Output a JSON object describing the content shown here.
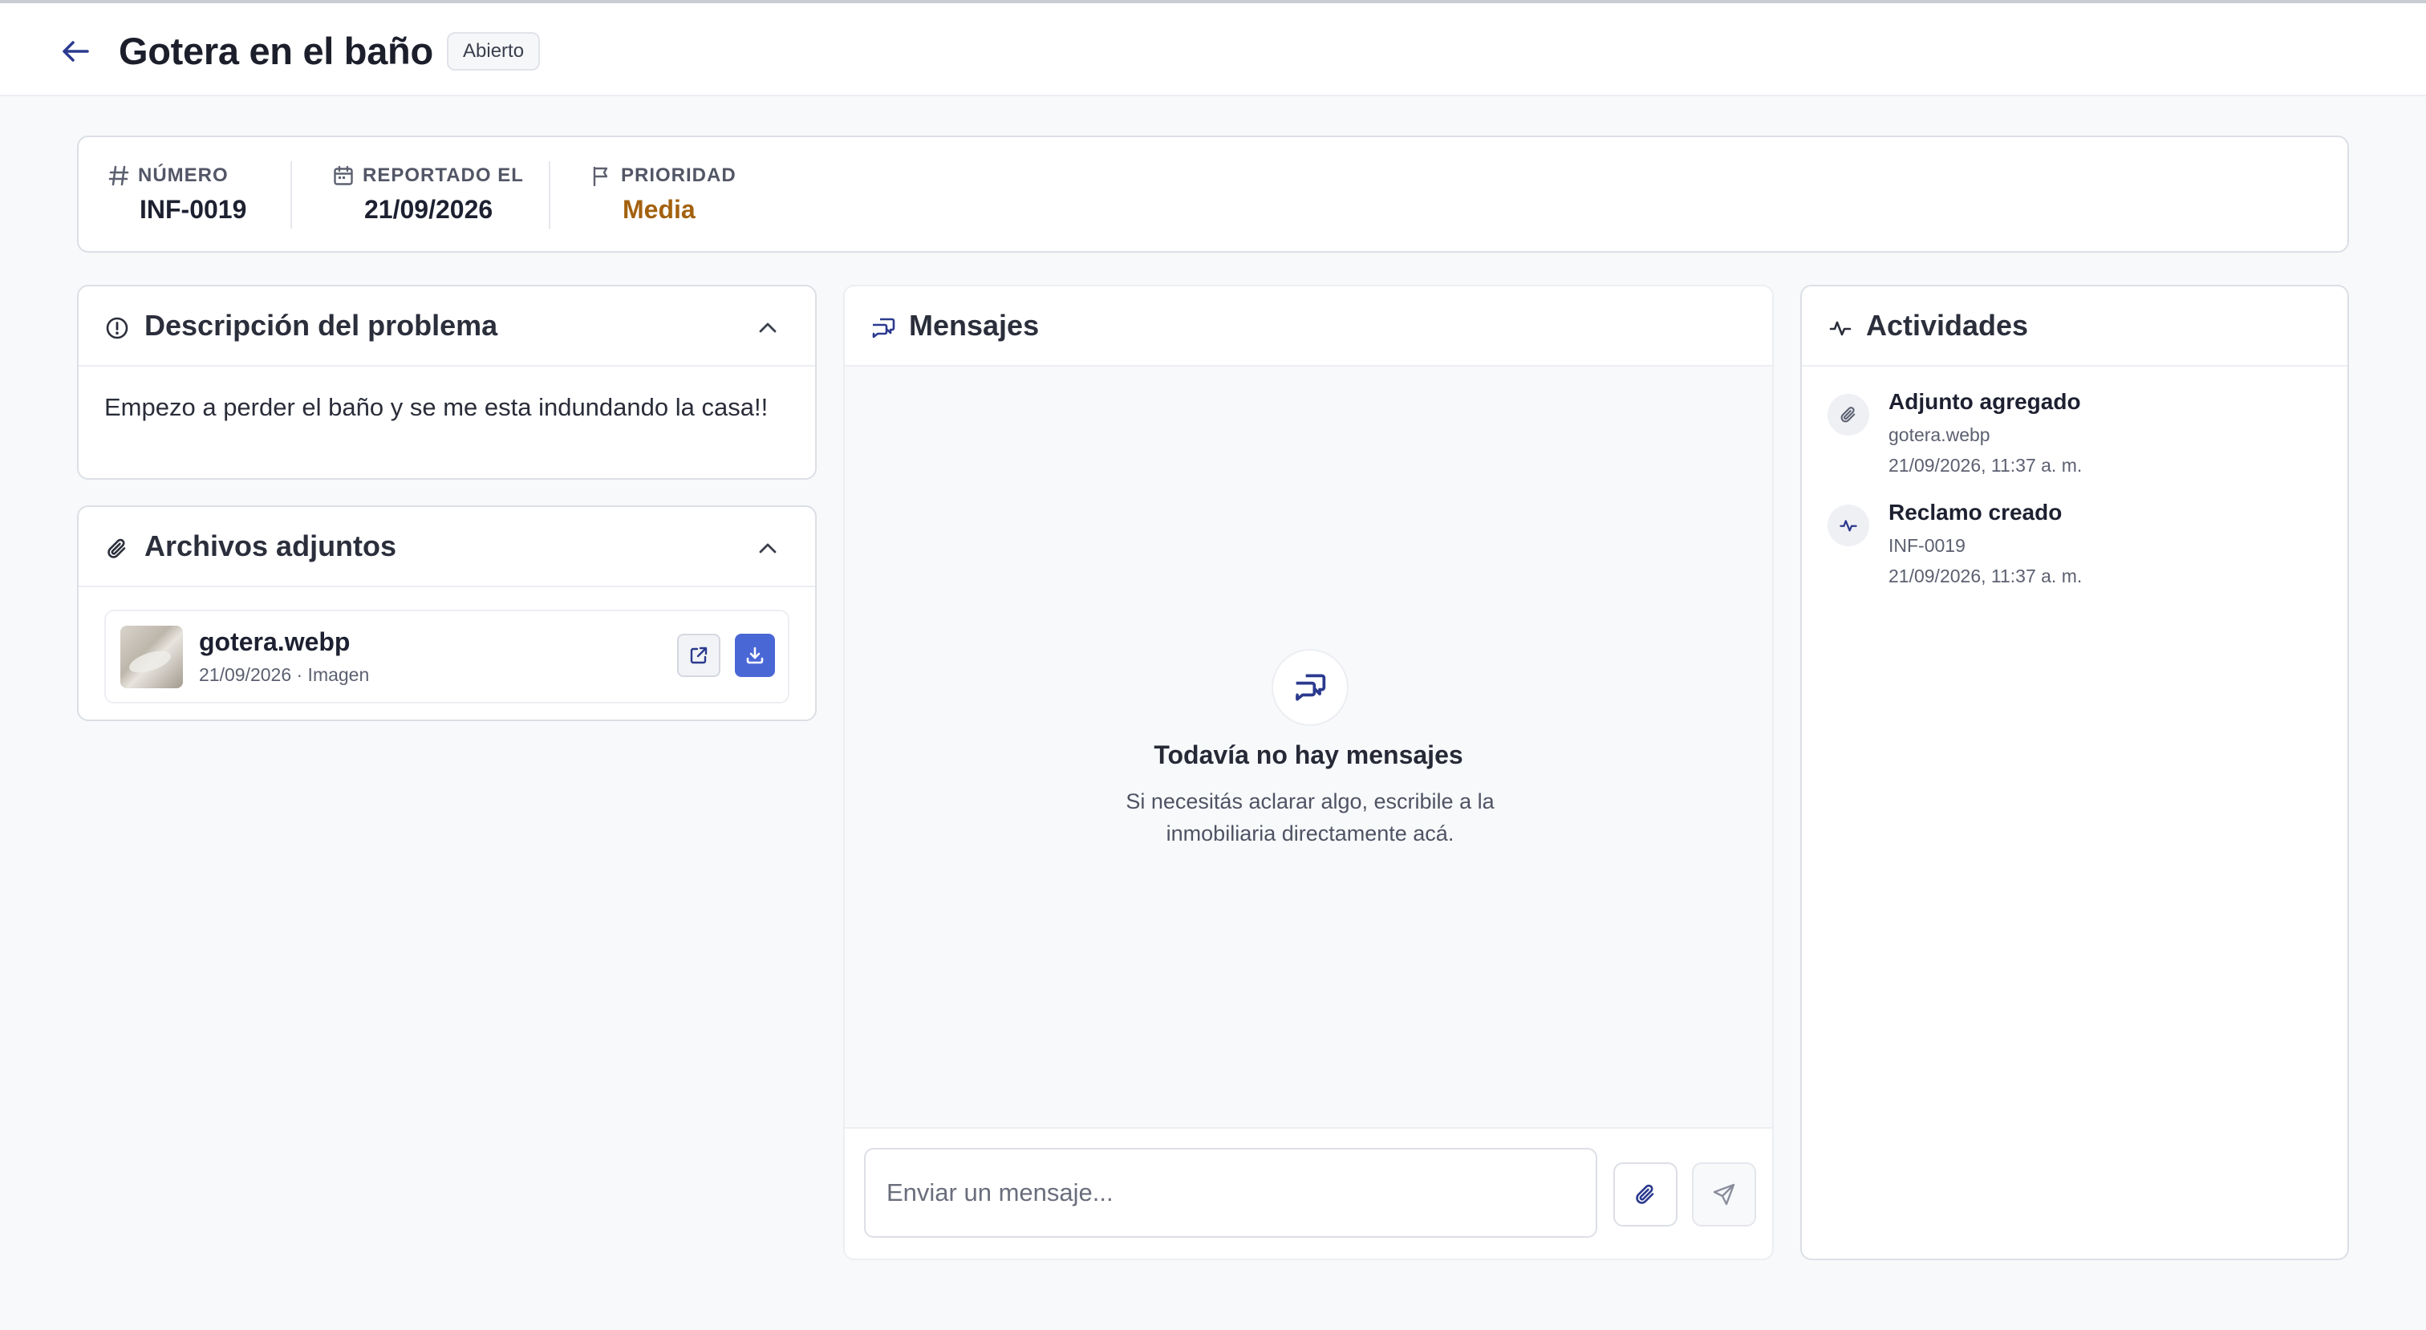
{
  "header": {
    "title": "Gotera en el baño",
    "status": "Abierto"
  },
  "info": {
    "numero_label": "NÚMERO",
    "numero_value": "INF-0019",
    "reportado_label": "REPORTADO EL",
    "reportado_value": "21/09/2026",
    "prioridad_label": "PRIORIDAD",
    "prioridad_value": "Media"
  },
  "description": {
    "title": "Descripción del problema",
    "text": "Empezo a perder el baño y se me esta indundando la casa!!"
  },
  "attachments": {
    "title": "Archivos adjuntos",
    "files": [
      {
        "name": "gotera.webp",
        "meta": "21/09/2026 · Imagen"
      }
    ]
  },
  "messages": {
    "title": "Mensajes",
    "empty_title": "Todavía no hay mensajes",
    "empty_subtitle": "Si necesitás aclarar algo, escribile a la inmobiliaria directamente acá.",
    "input_placeholder": "Enviar un mensaje..."
  },
  "activities": {
    "title": "Actividades",
    "items": [
      {
        "title": "Adjunto agregado",
        "detail": "gotera.webp",
        "date": "21/09/2026, 11:37 a. m.",
        "icon": "paperclip-icon"
      },
      {
        "title": "Reclamo creado",
        "detail": "INF-0019",
        "date": "21/09/2026, 11:37 a. m.",
        "icon": "activity-icon"
      }
    ]
  },
  "colors": {
    "accent": "#4a67d6",
    "priority_media": "#a3610f"
  }
}
